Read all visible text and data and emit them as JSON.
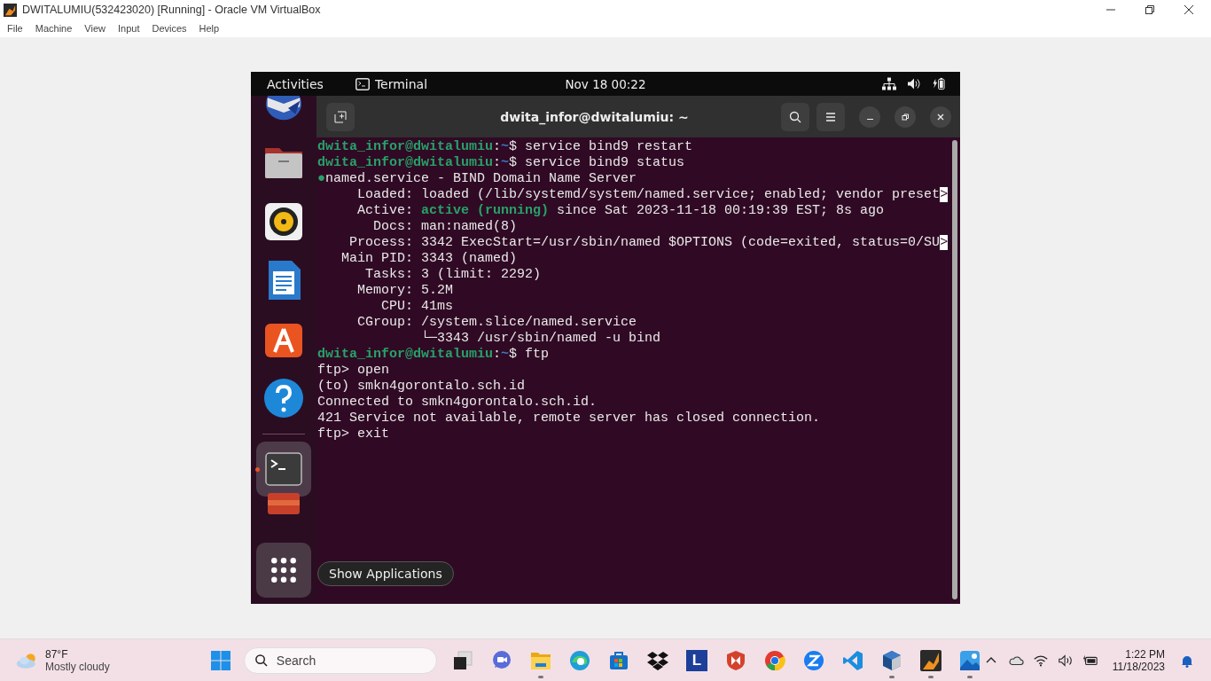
{
  "window": {
    "title": "DWITALUMIU(532423020) [Running] - Oracle VM VirtualBox"
  },
  "menu": [
    "File",
    "Machine",
    "View",
    "Input",
    "Devices",
    "Help"
  ],
  "vm": {
    "topbar": {
      "activities": "Activities",
      "app": "Terminal",
      "clock": "Nov 18  00:22"
    },
    "dock": [
      {
        "kind": "mail",
        "active": false
      },
      {
        "kind": "files",
        "active": false
      },
      {
        "kind": "music",
        "active": false
      },
      {
        "kind": "writer",
        "active": false
      },
      {
        "kind": "store",
        "active": false
      },
      {
        "kind": "help",
        "active": false
      },
      {
        "kind": "terminal",
        "active": true
      },
      {
        "kind": "partial",
        "active": false
      }
    ],
    "show_apps_tooltip": "Show Applications",
    "terminal": {
      "title": "dwita_infor@dwitalumiu: ~",
      "lines": [
        [
          {
            "text": "dwita_infor@dwitalumiu",
            "kind": "user"
          },
          {
            "text": ":",
            "kind": "plain"
          },
          {
            "text": "~",
            "kind": "path"
          },
          {
            "text": "$ service bind9 restart",
            "kind": "plain"
          }
        ],
        [
          {
            "text": "dwita_infor@dwitalumiu",
            "kind": "user"
          },
          {
            "text": ":",
            "kind": "plain"
          },
          {
            "text": "~",
            "kind": "path"
          },
          {
            "text": "$ service bind9 status",
            "kind": "plain"
          }
        ],
        [
          {
            "text": "●",
            "kind": "dot"
          },
          {
            "text": "named.service - BIND Domain Name Server",
            "kind": "plain"
          }
        ],
        [
          {
            "text": "     Loaded: loaded (/lib/systemd/system/named.service; enabled; vendor preset",
            "kind": "plain"
          },
          {
            "text": ">",
            "kind": "cut"
          }
        ],
        [
          {
            "text": "     Active: ",
            "kind": "plain"
          },
          {
            "text": "active (running)",
            "kind": "ok"
          },
          {
            "text": " since Sat 2023-11-18 00:19:39 EST; 8s ago",
            "kind": "plain"
          }
        ],
        [
          {
            "text": "       Docs: man:named(8)",
            "kind": "plain"
          }
        ],
        [
          {
            "text": "    Process: 3342 ExecStart=/usr/sbin/named $OPTIONS (code=exited, status=0/SU",
            "kind": "plain"
          },
          {
            "text": ">",
            "kind": "cut"
          }
        ],
        [
          {
            "text": "   Main PID: 3343 (named)",
            "kind": "plain"
          }
        ],
        [
          {
            "text": "      Tasks: 3 (limit: 2292)",
            "kind": "plain"
          }
        ],
        [
          {
            "text": "     Memory: 5.2M",
            "kind": "plain"
          }
        ],
        [
          {
            "text": "        CPU: 41ms",
            "kind": "plain"
          }
        ],
        [
          {
            "text": "     CGroup: /system.slice/named.service",
            "kind": "plain"
          }
        ],
        [
          {
            "text": "             └─3343 /usr/sbin/named -u bind",
            "kind": "plain"
          }
        ],
        [
          {
            "text": "dwita_infor@dwitalumiu",
            "kind": "user"
          },
          {
            "text": ":",
            "kind": "plain"
          },
          {
            "text": "~",
            "kind": "path"
          },
          {
            "text": "$ ftp",
            "kind": "plain"
          }
        ],
        [
          {
            "text": "ftp> open",
            "kind": "plain"
          }
        ],
        [
          {
            "text": "(to) smkn4gorontalo.sch.id",
            "kind": "plain"
          }
        ],
        [
          {
            "text": "Connected to smkn4gorontalo.sch.id.",
            "kind": "plain"
          }
        ],
        [
          {
            "text": "421 Service not available, remote server has closed connection.",
            "kind": "plain"
          }
        ],
        [
          {
            "text": "ftp> exit",
            "kind": "plain"
          }
        ]
      ]
    }
  },
  "taskbar": {
    "weather": {
      "temp": "87°F",
      "desc": "Mostly cloudy"
    },
    "search": {
      "placeholder": "Search"
    },
    "apps": [
      {
        "kind": "taskview",
        "running": false
      },
      {
        "kind": "chat",
        "running": false
      },
      {
        "kind": "folder",
        "running": true
      },
      {
        "kind": "edge",
        "running": false
      },
      {
        "kind": "store",
        "running": false
      },
      {
        "kind": "dropbox",
        "running": false
      },
      {
        "kind": "letter",
        "glyph": "L",
        "running": false
      },
      {
        "kind": "shield",
        "running": false
      },
      {
        "kind": "chrome",
        "running": false
      },
      {
        "kind": "zoom",
        "running": false
      },
      {
        "kind": "code",
        "running": false
      },
      {
        "kind": "vbox",
        "running": true
      },
      {
        "kind": "flame",
        "running": true
      },
      {
        "kind": "photos",
        "running": true
      }
    ],
    "time": "1:22 PM",
    "date": "11/18/2023"
  }
}
